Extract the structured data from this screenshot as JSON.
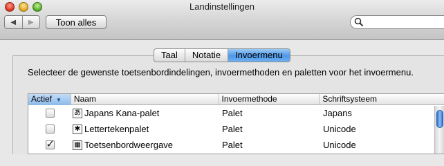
{
  "window": {
    "title": "Landinstellingen"
  },
  "toolbar": {
    "show_all_label": "Toon alles",
    "back_glyph": "◀",
    "forward_glyph": "▶"
  },
  "search": {
    "placeholder": ""
  },
  "tabs": [
    {
      "label": "Taal",
      "active": false
    },
    {
      "label": "Notatie",
      "active": false
    },
    {
      "label": "Invoermenu",
      "active": true
    }
  ],
  "description": "Selecteer de gewenste toetsenbordindelingen, invoermethoden en paletten voor het invoermenu.",
  "table": {
    "headers": {
      "active": "Actief",
      "name": "Naam",
      "method": "Invoermethode",
      "script": "Schriftsysteem"
    },
    "sort_indicator": "▼",
    "rows": [
      {
        "checked": false,
        "icon": "あ",
        "icon_name": "kana-palette-icon",
        "name": "Japans Kana-palet",
        "method": "Palet",
        "script": "Japans"
      },
      {
        "checked": false,
        "icon": "✱",
        "icon_name": "character-palette-icon",
        "name": "Lettertekenpalet",
        "method": "Palet",
        "script": "Unicode"
      },
      {
        "checked": true,
        "icon": "▦",
        "icon_name": "keyboard-viewer-icon",
        "name": "Toetsenbordweergave",
        "method": "Palet",
        "script": "Unicode"
      }
    ]
  },
  "colors": {
    "accent": "#4f97e6",
    "scroll_thumb": "#2f6fd0"
  }
}
